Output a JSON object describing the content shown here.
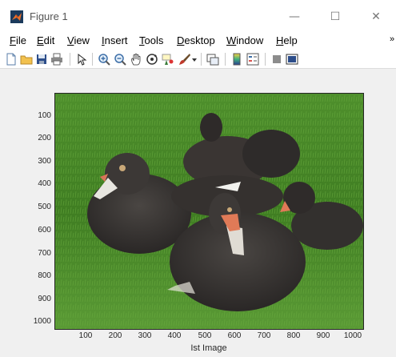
{
  "window": {
    "title": "Figure 1",
    "controls": {
      "minimize": "—",
      "maximize": "☐",
      "close": "✕"
    }
  },
  "menu": {
    "items": [
      {
        "accel": "F",
        "rest": "ile"
      },
      {
        "accel": "E",
        "rest": "dit"
      },
      {
        "accel": "V",
        "rest": "iew"
      },
      {
        "accel": "I",
        "rest": "nsert"
      },
      {
        "accel": "T",
        "rest": "ools"
      },
      {
        "accel": "D",
        "rest": "esktop"
      },
      {
        "accel": "W",
        "rest": "indow"
      },
      {
        "accel": "H",
        "rest": "elp"
      }
    ],
    "overflow": "»"
  },
  "toolbar": {
    "icons": [
      "new-figure-icon",
      "open-file-icon",
      "save-icon",
      "print-icon",
      "pointer-icon",
      "zoom-in-icon",
      "zoom-out-icon",
      "pan-icon",
      "rotate-3d-icon",
      "data-cursor-icon",
      "brush-icon",
      "link-plot-icon",
      "colorbar-icon",
      "legend-icon",
      "hide-plot-tools-icon",
      "show-plot-tools-icon"
    ]
  },
  "axes": {
    "image_subject": "ducks resting on grass",
    "yticks": [
      "100",
      "200",
      "300",
      "400",
      "500",
      "600",
      "700",
      "800",
      "900",
      "1000"
    ],
    "xticks": [
      "100",
      "200",
      "300",
      "400",
      "500",
      "600",
      "700",
      "800",
      "900",
      "1000"
    ],
    "xlabel": "Ist Image"
  },
  "colors": {
    "window_bg": "#ffffff",
    "figure_bg": "#f0f0f0",
    "axis_color": "#262626",
    "grass": "#3f7d22",
    "duck_dark": "#3a3634",
    "beak_orange": "#e07a57"
  }
}
